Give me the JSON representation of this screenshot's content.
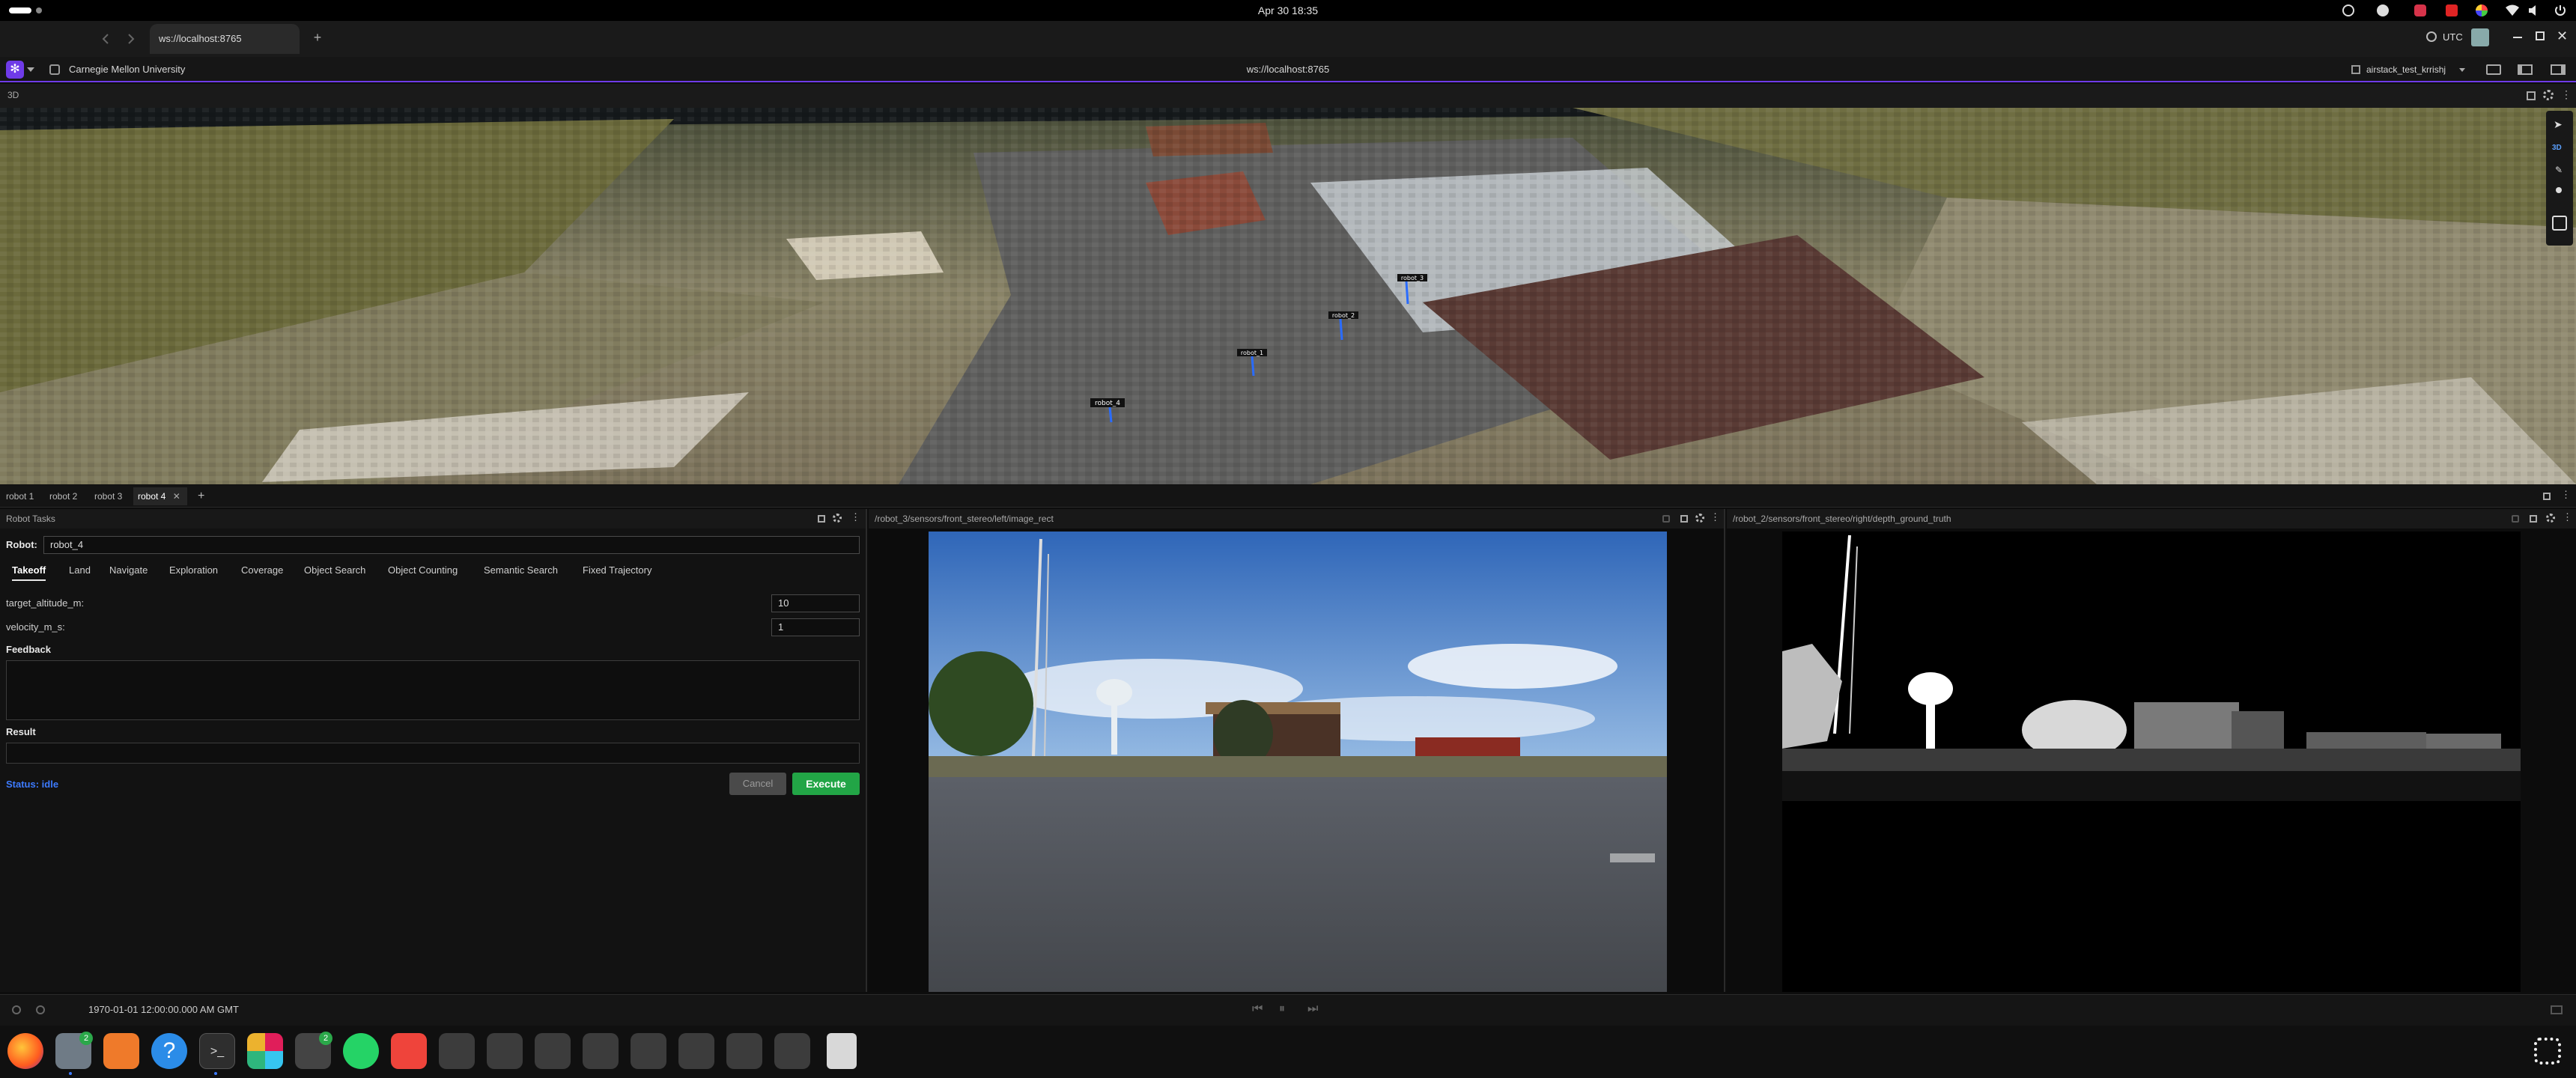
{
  "system_bar": {
    "clock": "Apr 30  18:35",
    "timezone": "UTC"
  },
  "browser": {
    "tab_title": "ws://localhost:8765",
    "new_tab_label": "+"
  },
  "app_bar": {
    "org": "Carnegie Mellon University",
    "connection": "ws://localhost:8765",
    "layout_name": "airstack_test_krrishj"
  },
  "panel_3d": {
    "title": "3D",
    "robot_markers": [
      "robot_3",
      "robot_2",
      "robot_1",
      "robot_4"
    ]
  },
  "robot_tabs": [
    {
      "label": "robot 1"
    },
    {
      "label": "robot 2"
    },
    {
      "label": "robot 3"
    },
    {
      "label": "robot 4",
      "active": true
    }
  ],
  "robot_tabs_add": "+",
  "tasks_panel": {
    "title": "Robot Tasks",
    "robot_label": "Robot:",
    "robot_value": "robot_4",
    "tabs": [
      "Takeoff",
      "Land",
      "Navigate",
      "Exploration",
      "Coverage",
      "Object Search",
      "Object Counting",
      "Semantic Search",
      "Fixed Trajectory"
    ],
    "active_tab": "Takeoff",
    "params": [
      {
        "name": "target_altitude_m:",
        "value": "10"
      },
      {
        "name": "velocity_m_s:",
        "value": "1"
      }
    ],
    "feedback_label": "Feedback",
    "result_label": "Result",
    "status": "Status: idle",
    "cancel_label": "Cancel",
    "execute_label": "Execute",
    "colors": {
      "execute": "#22a546",
      "status": "#3d7bff",
      "accent": "#6f3be8"
    }
  },
  "image_panel_left": {
    "topic": "/robot_3/sensors/front_stereo/left/image_rect"
  },
  "image_panel_right": {
    "topic": "/robot_2/sensors/front_stereo/right/depth_ground_truth"
  },
  "playback": {
    "timestamp": "1970-01-01 12:00:00.000 AM GMT"
  },
  "dock": {
    "apps": [
      "firefox-icon",
      "files-icon",
      "app-store-icon",
      "help-icon",
      "terminal-icon",
      "slack-icon",
      "drone-icon",
      "whatsapp-icon",
      "anydesk-icon",
      "gear-icon",
      "gear-icon",
      "gear-icon",
      "gear-icon",
      "gear-icon",
      "gear-icon",
      "gear-icon",
      "gear-icon",
      "trash-icon"
    ],
    "badges": {
      "files": "2",
      "drone": "2"
    }
  }
}
